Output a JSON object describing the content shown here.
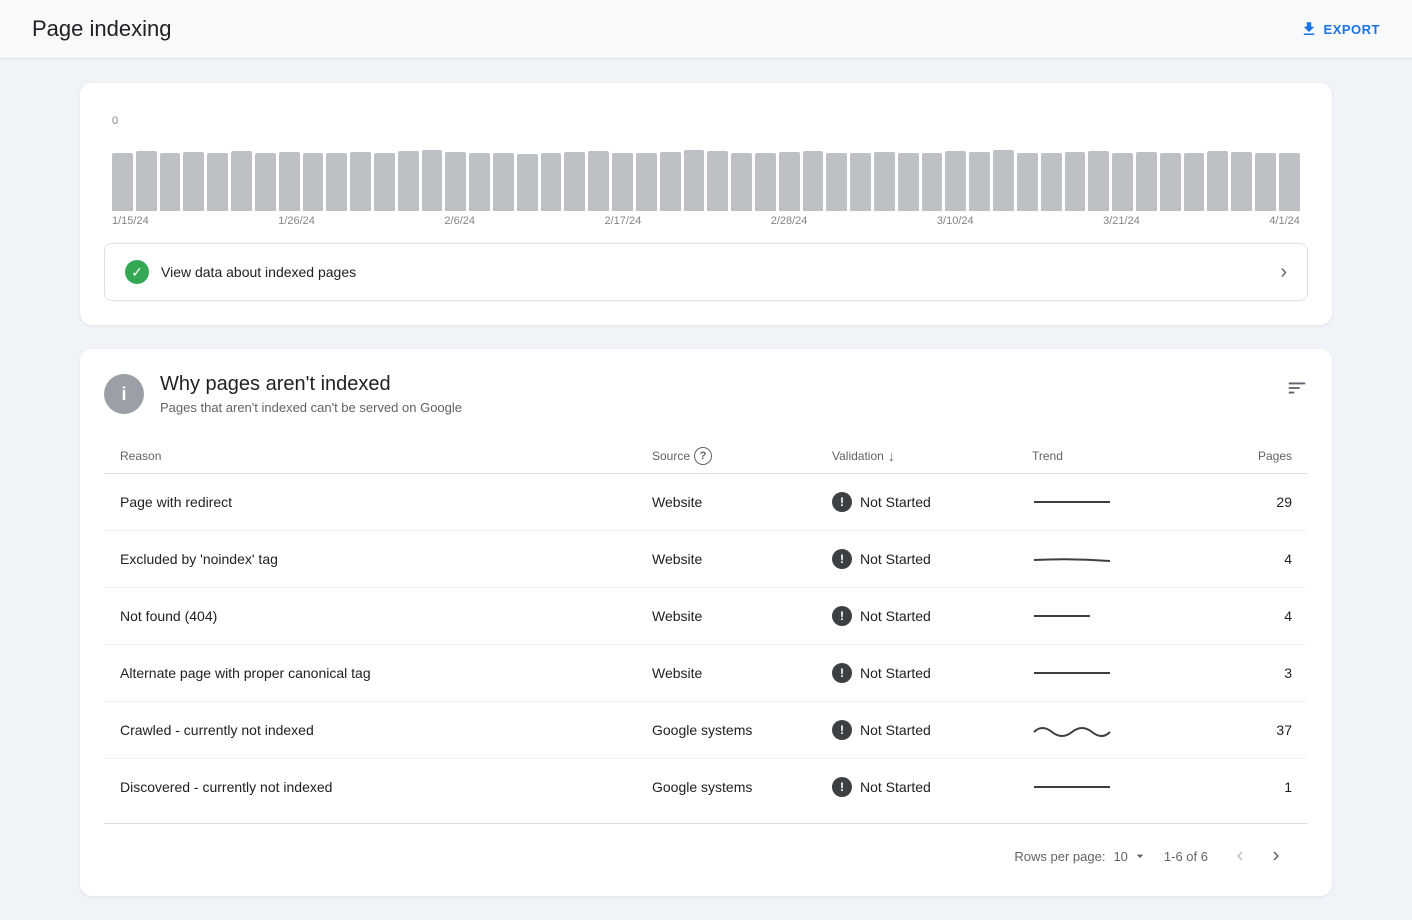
{
  "header": {
    "title": "Page indexing",
    "export_label": "EXPORT"
  },
  "chart": {
    "y_label": "0",
    "x_labels": [
      "1/15/24",
      "1/26/24",
      "2/6/24",
      "2/17/24",
      "2/28/24",
      "3/10/24",
      "3/21/24",
      "4/1/24"
    ],
    "bars": [
      72,
      75,
      73,
      74,
      72,
      75,
      73,
      74,
      72,
      73,
      74,
      72,
      75,
      76,
      74,
      73,
      72,
      71,
      73,
      74,
      75,
      73,
      72,
      74,
      76,
      75,
      73,
      72,
      74,
      75,
      73,
      72,
      74,
      73,
      72,
      75,
      74,
      76,
      73,
      72,
      74,
      75,
      73,
      74,
      72,
      73,
      75,
      74,
      73,
      72
    ]
  },
  "view_indexed": {
    "label": "View data about indexed pages"
  },
  "section": {
    "title": "Why pages aren't indexed",
    "subtitle": "Pages that aren't indexed can't be served on Google"
  },
  "table": {
    "columns": {
      "reason": "Reason",
      "source": "Source",
      "validation": "Validation",
      "trend": "Trend",
      "pages": "Pages"
    },
    "rows": [
      {
        "reason": "Page with redirect",
        "source": "Website",
        "validation": "Not Started",
        "pages": 29,
        "trend_type": "flat"
      },
      {
        "reason": "Excluded by 'noindex' tag",
        "source": "Website",
        "validation": "Not Started",
        "pages": 4,
        "trend_type": "slight"
      },
      {
        "reason": "Not found (404)",
        "source": "Website",
        "validation": "Not Started",
        "pages": 4,
        "trend_type": "short"
      },
      {
        "reason": "Alternate page with proper canonical tag",
        "source": "Website",
        "validation": "Not Started",
        "pages": 3,
        "trend_type": "flat"
      },
      {
        "reason": "Crawled - currently not indexed",
        "source": "Google systems",
        "validation": "Not Started",
        "pages": 37,
        "trend_type": "wavy"
      },
      {
        "reason": "Discovered - currently not indexed",
        "source": "Google systems",
        "validation": "Not Started",
        "pages": 1,
        "trend_type": "flat"
      }
    ]
  },
  "pagination": {
    "rows_per_page_label": "Rows per page:",
    "rows_per_page_value": "10",
    "page_range": "1-6 of 6"
  }
}
